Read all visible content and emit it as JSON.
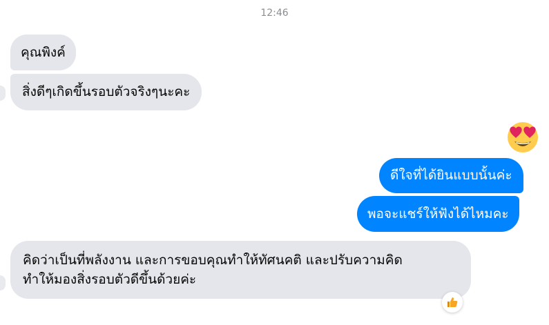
{
  "conversation": {
    "timestamp": "12:46",
    "messages": [
      {
        "side": "incoming",
        "text": "คุณพิงค์"
      },
      {
        "side": "incoming",
        "text": "สิ่งดีๆเกิดขึ้นรอบตัวจริงๆนะคะ"
      },
      {
        "side": "outgoing",
        "text": "ดีใจที่ได้ยินแบบนั้นค่ะ"
      },
      {
        "side": "outgoing",
        "text": "พอจะแชร์ให้ฟังได้ไหมคะ"
      },
      {
        "side": "incoming",
        "line1": "คิดว่าเป็นที่พลังงาน และการขอบคุณทำให้ทัศนคติ และปรับความคิด",
        "line2": "ทำให้มองสิ่งรอบตัวดีขึ้นด้วยค่ะ"
      }
    ],
    "reactions": {
      "outgoing_emoji": "heart-eyes-emoji-icon",
      "incoming_reaction": "thumbs-up-icon"
    }
  },
  "colors": {
    "incoming_bubble": "#e4e6eb",
    "outgoing_bubble": "#0084ff",
    "timestamp": "#8a8d91",
    "emoji_face": "#ffcc4d",
    "heart": "#e0245e",
    "thumbs": "#f5a623"
  }
}
